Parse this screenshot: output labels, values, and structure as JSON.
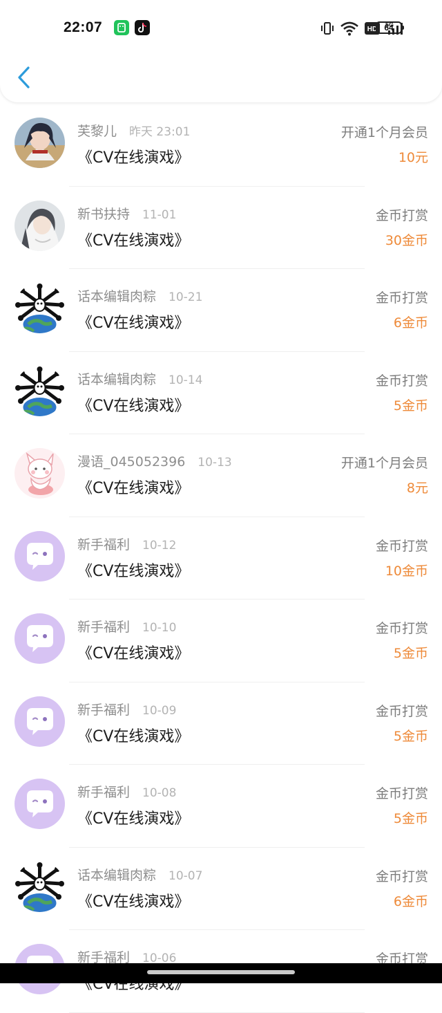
{
  "status_bar": {
    "time": "22:07",
    "network": "5G",
    "hd_label": "HD",
    "battery": "64"
  },
  "nav": {
    "back_icon": "chevron-left-icon"
  },
  "colors": {
    "accent": "#2d9cdb",
    "amount": "#ee8a39",
    "avatar_purple": "#d7c3f3"
  },
  "records": [
    {
      "user": "芙黎儿",
      "date": "昨天 23:01",
      "title": "《CV在线演戏》",
      "type": "开通1个月会员",
      "amount": "10元",
      "avatar": "anime-boy"
    },
    {
      "user": "新书扶持",
      "date": "11-01",
      "title": "《CV在线演戏》",
      "type": "金币打赏",
      "amount": "30金币",
      "avatar": "anime-white-hair"
    },
    {
      "user": "话本编辑肉粽",
      "date": "10-21",
      "title": "《CV在线演戏》",
      "type": "金币打赏",
      "amount": "6金币",
      "avatar": "earth-bones"
    },
    {
      "user": "话本编辑肉粽",
      "date": "10-14",
      "title": "《CV在线演戏》",
      "type": "金币打赏",
      "amount": "5金币",
      "avatar": "earth-bones"
    },
    {
      "user": "漫语_045052396",
      "date": "10-13",
      "title": "《CV在线演戏》",
      "type": "开通1个月会员",
      "amount": "8元",
      "avatar": "pink-cat"
    },
    {
      "user": "新手福利",
      "date": "10-12",
      "title": "《CV在线演戏》",
      "type": "金币打赏",
      "amount": "10金币",
      "avatar": "chat-bubble"
    },
    {
      "user": "新手福利",
      "date": "10-10",
      "title": "《CV在线演戏》",
      "type": "金币打赏",
      "amount": "5金币",
      "avatar": "chat-bubble"
    },
    {
      "user": "新手福利",
      "date": "10-09",
      "title": "《CV在线演戏》",
      "type": "金币打赏",
      "amount": "5金币",
      "avatar": "chat-bubble"
    },
    {
      "user": "新手福利",
      "date": "10-08",
      "title": "《CV在线演戏》",
      "type": "金币打赏",
      "amount": "5金币",
      "avatar": "chat-bubble"
    },
    {
      "user": "话本编辑肉粽",
      "date": "10-07",
      "title": "《CV在线演戏》",
      "type": "金币打赏",
      "amount": "6金币",
      "avatar": "earth-bones"
    },
    {
      "user": "新手福利",
      "date": "10-06",
      "title": "《CV在线演戏》",
      "type": "金币打赏",
      "amount": "",
      "avatar": "chat-bubble"
    }
  ]
}
